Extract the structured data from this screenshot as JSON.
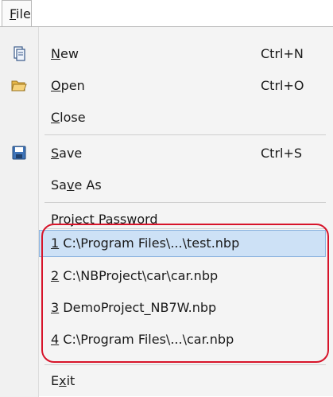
{
  "menubar": {
    "file_prefix": "F",
    "file_rest": "ile"
  },
  "menu": {
    "new": {
      "prefix": "",
      "mn": "N",
      "rest": "ew",
      "shortcut": "Ctrl+N"
    },
    "open": {
      "prefix": "",
      "mn": "O",
      "rest": "pen",
      "shortcut": "Ctrl+O"
    },
    "close": {
      "prefix": "",
      "mn": "C",
      "rest": "lose"
    },
    "save": {
      "prefix": "",
      "mn": "S",
      "rest": "ave",
      "shortcut": "Ctrl+S"
    },
    "save_as": {
      "prefix": "Sa",
      "mn": "v",
      "rest": "e As"
    },
    "project_password": {
      "prefix": "",
      "mn": "P",
      "rest": "roject Password"
    },
    "exit": {
      "prefix": "E",
      "mn": "x",
      "rest": "it"
    }
  },
  "recent": [
    {
      "num": "1",
      "path": " C:\\Program Files\\...\\test.nbp"
    },
    {
      "num": "2",
      "path": " C:\\NBProject\\car\\car.nbp"
    },
    {
      "num": "3",
      "path": " DemoProject_NB7W.nbp"
    },
    {
      "num": "4",
      "path": " C:\\Program Files\\...\\car.nbp"
    }
  ],
  "icons": {
    "new": "new-document-icon",
    "open": "open-folder-icon",
    "save": "save-floppy-icon"
  },
  "colors": {
    "highlight_fill": "#cde1f6",
    "highlight_border": "#8eb5e0",
    "annotation_red": "#d7142a"
  }
}
